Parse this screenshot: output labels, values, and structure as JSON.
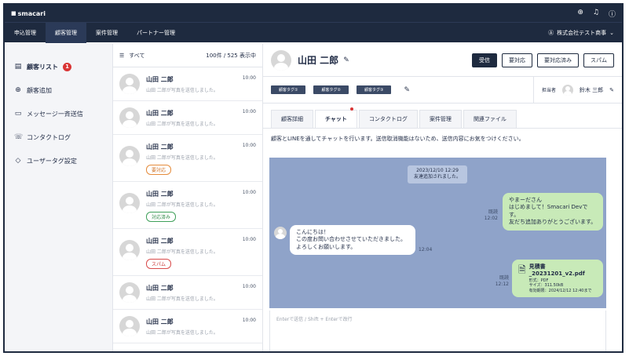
{
  "app": {
    "logo": "smacari"
  },
  "nav": {
    "tabs": [
      "申込管理",
      "顧客管理",
      "案件管理",
      "パートナー管理"
    ],
    "active": 1,
    "company": "株式会社テスト商事"
  },
  "sidebar": {
    "items": [
      {
        "label": "顧客リスト",
        "badge": "1"
      },
      {
        "label": "顧客追加"
      },
      {
        "label": "メッセージ一斉送信"
      },
      {
        "label": "コンタクトログ"
      },
      {
        "label": "ユーザータグ設定"
      }
    ]
  },
  "list": {
    "filter": "すべて",
    "count": "100件 / 525 表示中",
    "items": [
      {
        "name": "山田 二郎",
        "msg": "山田 二郎が写真を送信しました。",
        "time": "10:00"
      },
      {
        "name": "山田 二郎",
        "msg": "山田 二郎が写真を送信しました。",
        "time": "10:00"
      },
      {
        "name": "山田 二郎",
        "msg": "山田 二郎が写真を送信しました。",
        "time": "10:00",
        "tag": "要対応"
      },
      {
        "name": "山田 二郎",
        "msg": "山田 二郎が写真を送信しました。",
        "time": "10:00",
        "tag": "対応済み"
      },
      {
        "name": "山田 二郎",
        "msg": "山田 二郎が写真を送信しました。",
        "time": "10:00",
        "tag": "スパム"
      },
      {
        "name": "山田 二郎",
        "msg": "山田 二郎が写真を送信しました。",
        "time": "10:00"
      },
      {
        "name": "山田 二郎",
        "msg": "山田 二郎が写真を送信しました。",
        "time": "10:00"
      }
    ]
  },
  "customer": {
    "name": "山田 二郎",
    "actions": [
      "受信",
      "要対応",
      "要対応済み",
      "スパム"
    ],
    "tags": [
      "顧客タグ①",
      "顧客タグ②",
      "顧客タグ③"
    ],
    "owner_label": "担当者",
    "owner": "鈴木 三郎"
  },
  "tabs": [
    "顧客詳細",
    "チャット",
    "コンタクトログ",
    "案件管理",
    "関連ファイル"
  ],
  "notice": "顧客とLINEを通してチャットを行います。送信取消機能はないため、送信内容にお気をつけください。",
  "chat": {
    "system": {
      "date": "2023/12/10 12:29",
      "text": "友達追加されました。"
    },
    "out1": {
      "lines": [
        "やまーださん",
        "はじめまして！Smacari Devです。",
        "友だち追加ありがとうございます。"
      ],
      "read": "既読",
      "time": "12:02"
    },
    "in1": {
      "lines": [
        "こんにちは！",
        "この度お問い合わせさせていただきました。",
        "よろしくお願いします。"
      ],
      "time": "12:04"
    },
    "file": {
      "name": "見積書_20231201_v2.pdf",
      "type": "形式：PDF",
      "size": "サイズ：311.50kB",
      "expire": "有効期限：2024/12/12 12:40まで",
      "read": "既読",
      "time": "12:12"
    }
  },
  "input": {
    "placeholder": "Enterで送信 / Shift + Enterで改行"
  }
}
